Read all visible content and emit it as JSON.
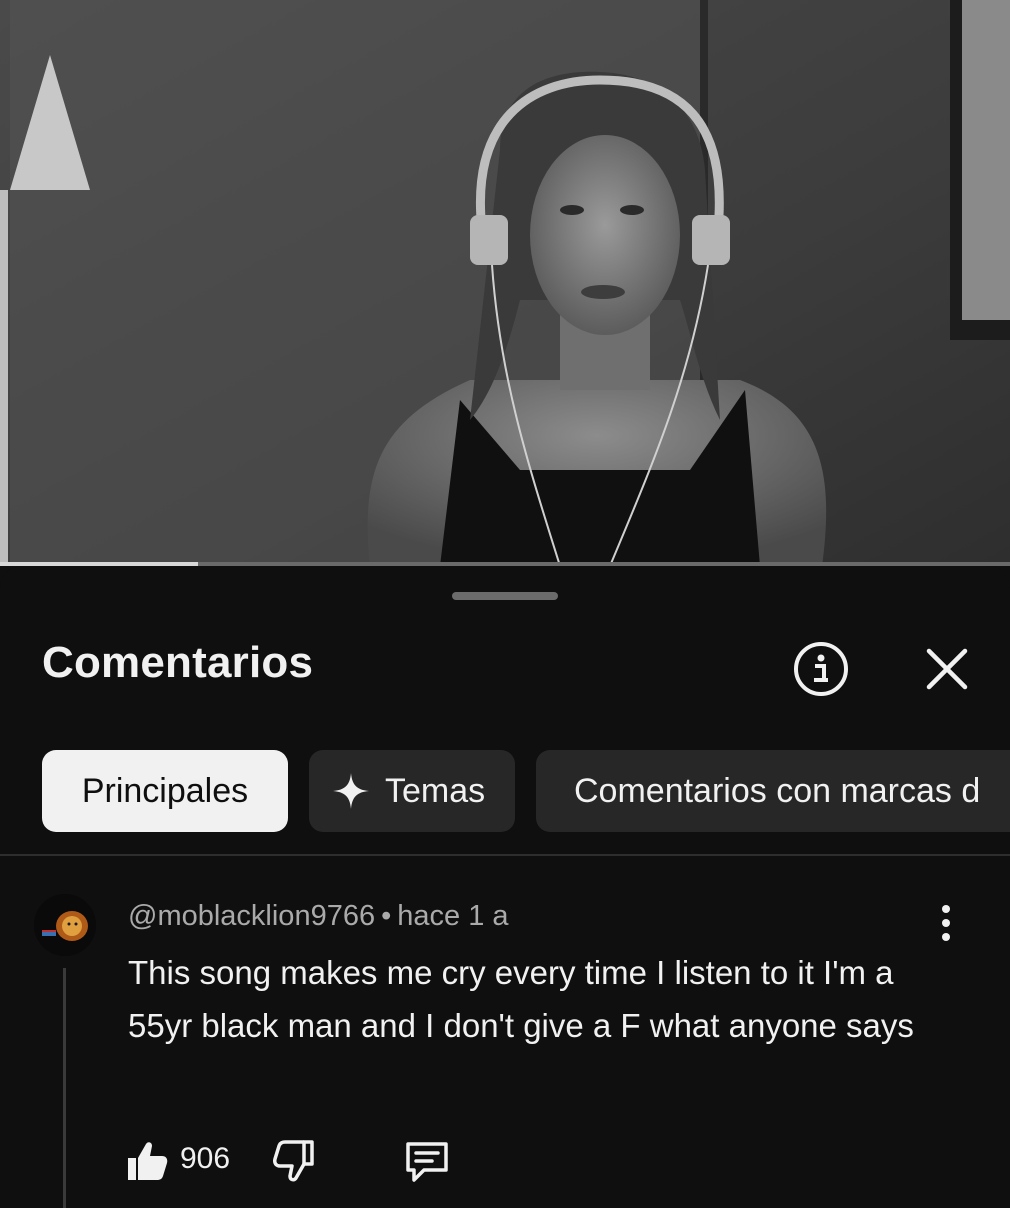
{
  "video": {
    "progress_fraction": 0.196,
    "scene": "grayscale-video-frame"
  },
  "comments_panel": {
    "title": "Comentarios",
    "info_icon": "info-icon",
    "close_icon": "close-icon",
    "chips": [
      {
        "label": "Principales",
        "active": true
      },
      {
        "label": "Temas",
        "icon": "sparkle-icon",
        "active": false
      },
      {
        "label": "Comentarios con marcas d",
        "active": false
      }
    ]
  },
  "comment": {
    "author": "@moblacklion9766",
    "separator": "•",
    "time": "hace 1 a",
    "text": "This song makes me cry every time I listen to it I'm a 55yr black man and I don't give a F what anyone says",
    "likes": "906",
    "menu_icon": "more-vert-icon",
    "like_icon": "thumbs-up-icon",
    "dislike_icon": "thumbs-down-icon",
    "reply_icon": "reply-comment-icon"
  },
  "colors": {
    "background": "#0f0f0f",
    "chip": "#272727",
    "chip_active": "#f1f1f1",
    "secondary_text": "#aaaaaa"
  }
}
